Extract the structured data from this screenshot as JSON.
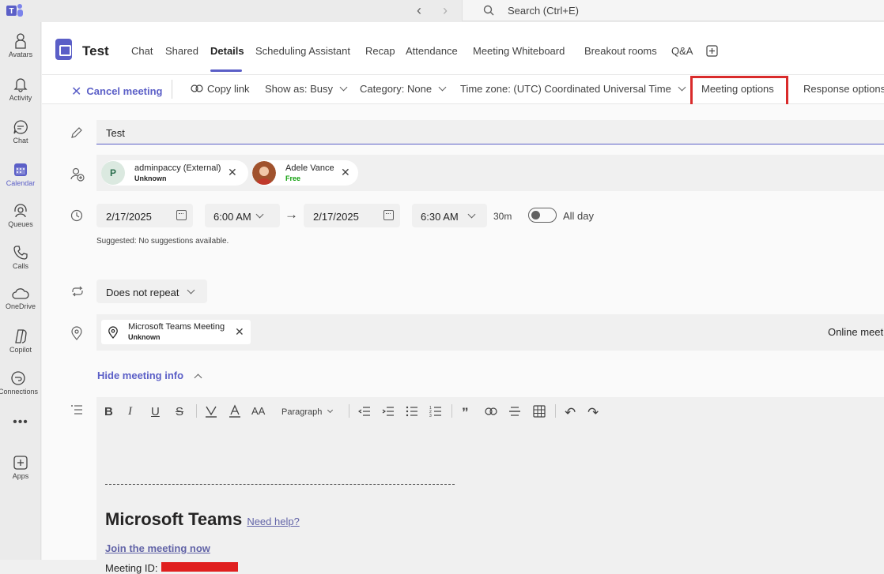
{
  "topbar": {
    "search_placeholder": "Search (Ctrl+E)"
  },
  "rail": [
    {
      "label": "Avatars",
      "icon": "avatar-icon"
    },
    {
      "label": "Activity",
      "icon": "bell-icon"
    },
    {
      "label": "Chat",
      "icon": "chat-icon"
    },
    {
      "label": "Calendar",
      "icon": "calendar-icon"
    },
    {
      "label": "Queues",
      "icon": "queues-icon"
    },
    {
      "label": "Calls",
      "icon": "phone-icon"
    },
    {
      "label": "OneDrive",
      "icon": "cloud-icon"
    },
    {
      "label": "Copilot",
      "icon": "copilot-icon"
    },
    {
      "label": "Connections",
      "icon": "connections-icon"
    },
    {
      "label": "Apps",
      "icon": "plus-square-icon"
    }
  ],
  "header": {
    "title": "Test",
    "tabs": [
      "Chat",
      "Shared",
      "Details",
      "Scheduling Assistant",
      "Recap",
      "Attendance",
      "Meeting Whiteboard",
      "Breakout rooms",
      "Q&A"
    ]
  },
  "toolbar": {
    "cancel": "Cancel meeting",
    "copy_link": "Copy link",
    "show_as": "Show as: Busy",
    "category": "Category: None",
    "time_zone": "Time zone: (UTC) Coordinated Universal Time",
    "meeting_options": "Meeting options",
    "response_options": "Response options"
  },
  "form": {
    "title_value": "Test",
    "attendees": [
      {
        "initial": "P",
        "name": "adminpaccy (External)",
        "status": "Unknown"
      },
      {
        "name": "Adele Vance",
        "status": "Free"
      }
    ],
    "start_date": "2/17/2025",
    "start_time": "6:00 AM",
    "end_date": "2/17/2025",
    "end_time": "6:30 AM",
    "duration": "30m",
    "all_day": "All day",
    "suggestion": "Suggested: No suggestions available.",
    "repeat": "Does not repeat",
    "location_name": "Microsoft Teams Meeting",
    "location_status": "Unknown",
    "online_label": "Online meet",
    "hide_info": "Hide meeting info"
  },
  "editor": {
    "paragraph": "Paragraph",
    "teams_title": "Microsoft Teams",
    "need_help": "Need help?",
    "join_link": "Join the meeting now",
    "meeting_id_label": "Meeting ID:"
  },
  "colors": {
    "accent": "#5b5fc7",
    "highlight": "#d92b2b",
    "free": "#13a10e"
  }
}
